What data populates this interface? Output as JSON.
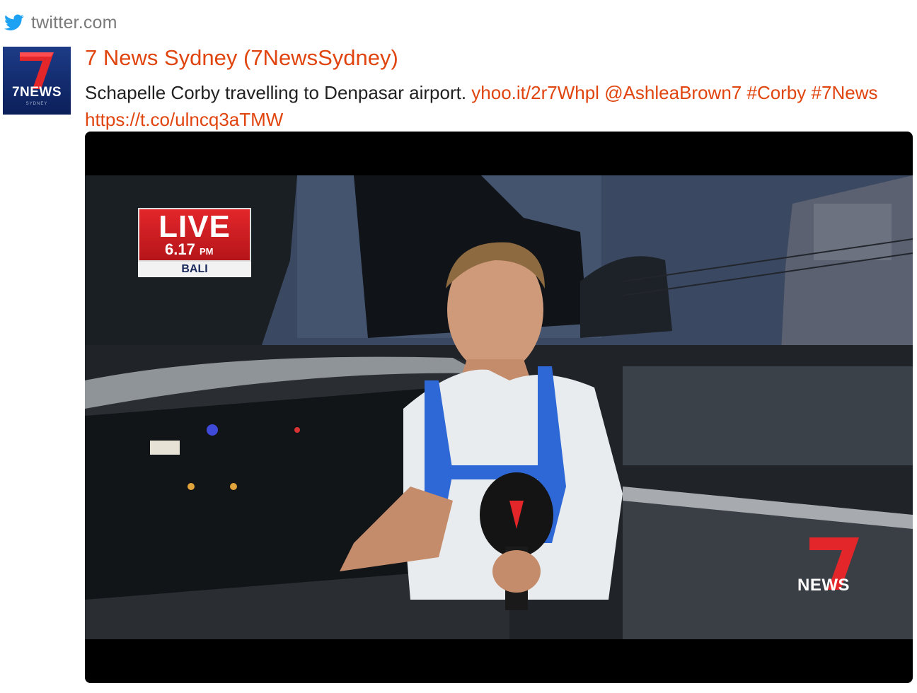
{
  "source": {
    "icon": "twitter-bird-icon",
    "label": "twitter.com"
  },
  "tweet": {
    "author": "7 News Sydney (7NewsSydney)",
    "text": "Schapelle Corby travelling to Denpasar airport.",
    "links": [
      "yhoo.it/2r7Whpl",
      "@AshleaBrown7",
      "#Corby",
      "#7News",
      "https://t.co/ulncq3aTMW"
    ]
  },
  "avatar": {
    "logo": "7NEWS",
    "sub": "SYDNEY"
  },
  "video": {
    "overlay": {
      "live": "LIVE",
      "time": "6.17",
      "period": "PM",
      "location": "BALI"
    },
    "watermark": "NEWS"
  },
  "colors": {
    "link": "#e0450f",
    "source": "#7a7a7a",
    "twitter_blue": "#1da1f2",
    "brand_red": "#e3262a"
  }
}
